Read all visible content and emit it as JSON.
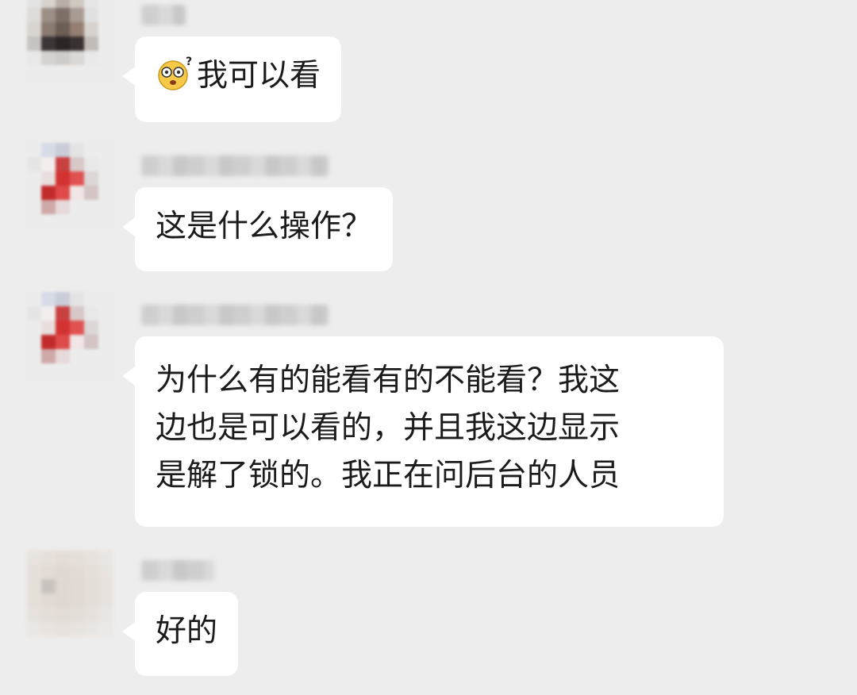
{
  "messages": [
    {
      "text": "我可以看",
      "has_emoji": true,
      "emoji": "dizzy-face-emoji"
    },
    {
      "text": "这是什么操作？"
    },
    {
      "lines": [
        "为什么有的能看有的不能看？我这",
        "边也是可以看的，并且我这边显示",
        "是解了锁的。我正在问后台的人员"
      ]
    },
    {
      "text": "好的"
    }
  ],
  "colors": {
    "background": "#ededed",
    "bubble": "#ffffff",
    "text": "#1b1b1b"
  }
}
